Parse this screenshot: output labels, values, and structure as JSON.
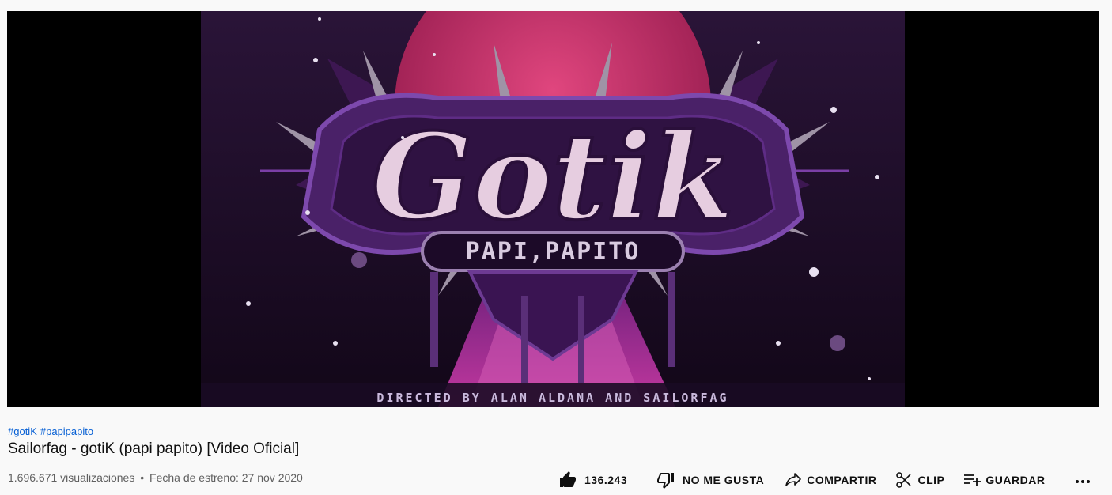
{
  "video": {
    "hashtags": [
      "#gotiK",
      "#papipapito"
    ],
    "title": "Sailorfag - gotiK (papi papito) [Video Oficial]",
    "views": "1.696.671 visualizaciones",
    "separator": "•",
    "premiere": "Fecha de estreno: 27 nov 2020",
    "thumbnail": {
      "logo_text": "Gotik",
      "subtitle": "PAPI,PAPITO",
      "credits": "DIRECTED BY ALAN ALDANA AND SAILORFAG"
    }
  },
  "actions": {
    "like_count": "136.243",
    "dislike_label": "NO ME GUSTA",
    "share_label": "COMPARTIR",
    "clip_label": "CLIP",
    "save_label": "GUARDAR"
  },
  "icons": {
    "like": "thumbs-up-icon",
    "dislike": "thumbs-down-icon",
    "share": "share-arrow-icon",
    "clip": "scissors-icon",
    "save": "playlist-add-icon",
    "more": "more-horizontal-icon"
  },
  "colors": {
    "page_bg": "#f9f9f9",
    "hashtag": "#065fd4",
    "title": "#0f0f0f",
    "meta": "#606060",
    "frame_bg": "#1f0d2c",
    "moon": "#c72e6a",
    "beam": "#b93a9c",
    "logo_fill": "#e6cde0",
    "logo_frame": "#6a3396"
  }
}
